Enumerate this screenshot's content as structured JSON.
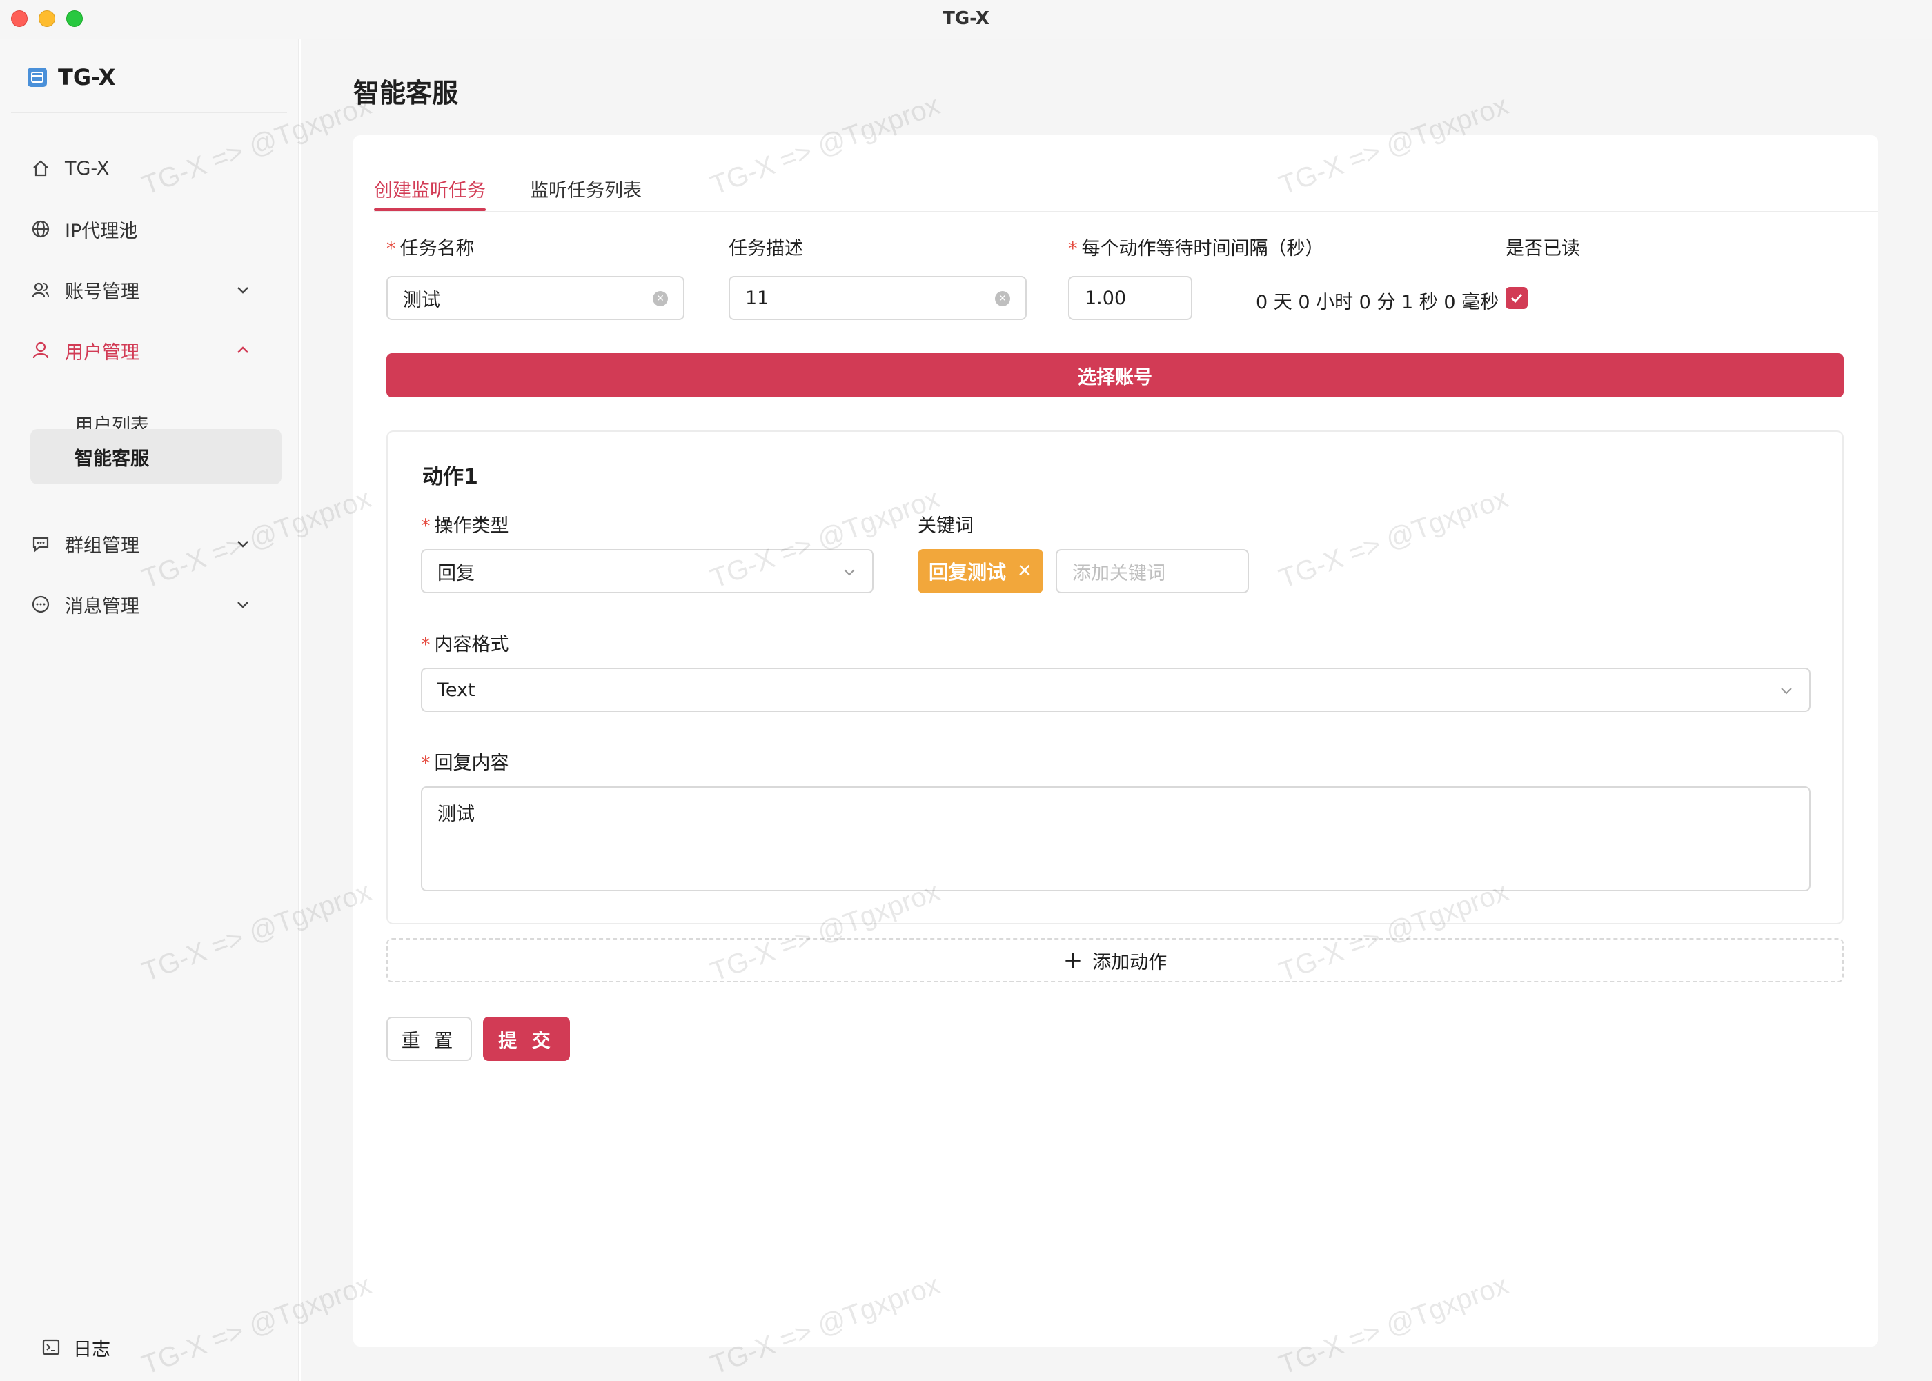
{
  "window": {
    "title": "TG-X"
  },
  "sidebar": {
    "brand": "TG-X",
    "items": [
      {
        "label": "TG-X",
        "icon": "home-icon"
      },
      {
        "label": "IP代理池",
        "icon": "globe-icon"
      },
      {
        "label": "账号管理",
        "icon": "user-group-icon",
        "expanded": false
      },
      {
        "label": "用户管理",
        "icon": "user-icon",
        "expanded": true,
        "active": true
      },
      {
        "label": "群组管理",
        "icon": "chat-icon",
        "expanded": false
      },
      {
        "label": "消息管理",
        "icon": "message-icon",
        "expanded": false
      }
    ],
    "sub_items": [
      {
        "label": "用户列表"
      },
      {
        "label": "智能客服",
        "selected": true
      }
    ],
    "log": "日志"
  },
  "page": {
    "title": "智能客服"
  },
  "tabs": [
    {
      "label": "创建监听任务",
      "active": true
    },
    {
      "label": "监听任务列表"
    }
  ],
  "form": {
    "task_name": {
      "label": "任务名称",
      "value": "测试"
    },
    "task_desc": {
      "label": "任务描述",
      "value": "11"
    },
    "interval": {
      "label": "每个动作等待时间间隔（秒）",
      "value": "1.00",
      "duration": "0 天  0 小时  0 分  1 秒  0 毫秒"
    },
    "is_read": {
      "label": "是否已读",
      "checked": true
    },
    "select_account": "选择账号"
  },
  "action": {
    "title": "动作1",
    "op_type": {
      "label": "操作类型",
      "value": "回复"
    },
    "keywords": {
      "label": "关键词",
      "tags": [
        "回复测试"
      ],
      "placeholder": "添加关键词"
    },
    "content_format": {
      "label": "内容格式",
      "value": "Text"
    },
    "reply_content": {
      "label": "回复内容",
      "value": "测试"
    }
  },
  "add_action": "添加动作",
  "buttons": {
    "reset": "重 置",
    "submit": "提 交"
  },
  "watermark": "TG-X => @Tgxprox",
  "colors": {
    "accent": "#d23b55",
    "tag": "#f2a73b"
  }
}
